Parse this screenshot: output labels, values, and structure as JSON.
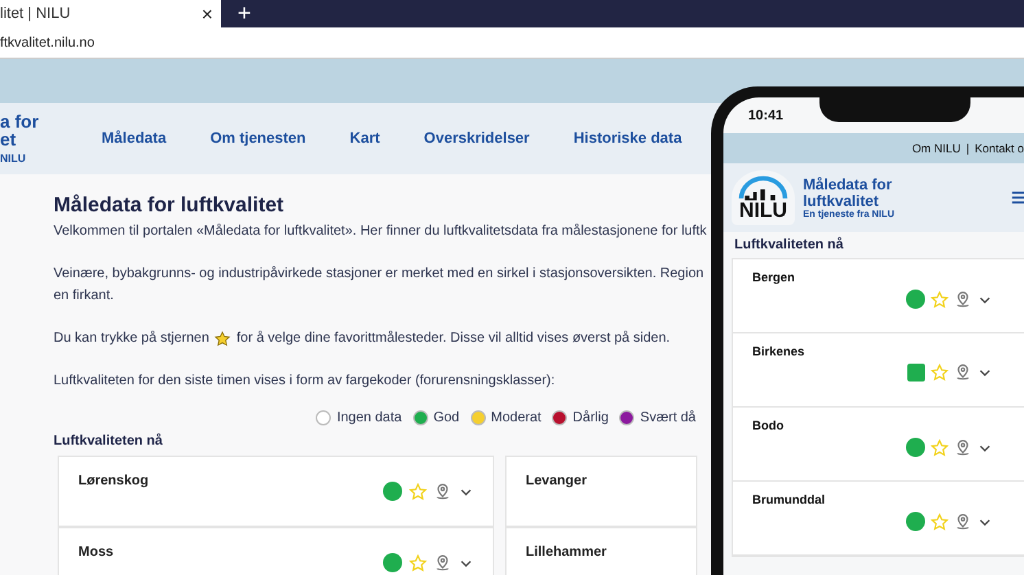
{
  "browser": {
    "tab_title": "litet | NILU",
    "tab_close": "×",
    "new_tab": "+",
    "address": "ftkvalitet.nilu.no"
  },
  "header": {
    "logo_lines": [
      "a for",
      "et"
    ],
    "logo_sub": "NILU",
    "nav": [
      "Måledata",
      "Om tjenesten",
      "Kart",
      "Overskridelser",
      "Historiske data"
    ]
  },
  "intro": {
    "title": "Måledata for luftkvalitet",
    "paragraphs": [
      {
        "kind": "text",
        "text": "Velkommen til portalen «Måledata for luftkvalitet». Her finner du luftkvalitetsdata fra målestasjonene for luftk"
      },
      {
        "kind": "text",
        "text": "Veinære, bybakgrunns- og industripåvirkede stasjoner er merket med en sirkel i stasjonsoversikten. Region"
      },
      {
        "kind": "text",
        "text": "en firkant."
      },
      {
        "kind": "star",
        "before": "Du kan trykke på stjernen",
        "after": "for å velge dine favorittmålesteder. Disse vil alltid vises øverst på siden."
      },
      {
        "kind": "text",
        "text": "Luftkvaliteten for den siste timen vises i form av fargekoder (forurensningsklasser):"
      }
    ]
  },
  "legend": [
    {
      "label": "Ingen data",
      "color": "#ffffff"
    },
    {
      "label": "God",
      "color": "#1fae4f"
    },
    {
      "label": "Moderat",
      "color": "#f5cf2f"
    },
    {
      "label": "Dårlig",
      "color": "#b8102e"
    },
    {
      "label": "Svært då",
      "color": "#8c1a9e"
    }
  ],
  "stations_heading": "Luftkvaliteten nå",
  "stations": [
    {
      "name": "Lørenskog",
      "color": "#1fae4f"
    },
    {
      "name": "Levanger"
    },
    {
      "name": "Moss",
      "color": "#1fae4f"
    },
    {
      "name": "Lillehammer"
    }
  ],
  "phone": {
    "time": "10:41",
    "links": [
      "Om NILU",
      "|",
      "Kontakt o"
    ],
    "logo": "NILU",
    "title": "Måledata for luftkvalitet",
    "subtitle": "En tjeneste fra NILU",
    "heading": "Luftkvaliteten nå",
    "stations": [
      {
        "name": "Bergen",
        "kind": "circle",
        "color": "#1fae4f"
      },
      {
        "name": "Birkenes",
        "kind": "square",
        "color": "#1fae4f"
      },
      {
        "name": "Bodo",
        "kind": "circle",
        "color": "#1fae4f"
      },
      {
        "name": "Brumunddal",
        "kind": "circle",
        "color": "#1fae4f"
      }
    ]
  }
}
